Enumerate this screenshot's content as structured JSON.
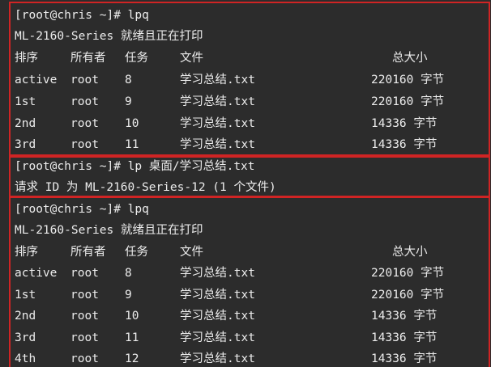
{
  "terminal": {
    "block1": {
      "prompt": "[root@chris ~]# lpq",
      "status": "ML-2160-Series 就绪且正在打印",
      "headers": {
        "rank": "排序",
        "owner": "所有者",
        "job": "任务",
        "file": "文件",
        "size": "总大小"
      },
      "rows": [
        {
          "rank": "active",
          "owner": "root",
          "job": "8",
          "file": "学习总结.txt",
          "size": "220160 字节"
        },
        {
          "rank": "1st",
          "owner": "root",
          "job": "9",
          "file": "学习总结.txt",
          "size": "220160 字节"
        },
        {
          "rank": "2nd",
          "owner": "root",
          "job": "10",
          "file": "学习总结.txt",
          "size": "14336 字节"
        },
        {
          "rank": "3rd",
          "owner": "root",
          "job": "11",
          "file": "学习总结.txt",
          "size": "14336 字节"
        }
      ]
    },
    "block2": {
      "prompt": "[root@chris ~]# lp 桌面/学习总结.txt",
      "result": "请求 ID 为 ML-2160-Series-12 (1 个文件)"
    },
    "block3": {
      "prompt": "[root@chris ~]# lpq",
      "status": "ML-2160-Series 就绪且正在打印",
      "headers": {
        "rank": "排序",
        "owner": "所有者",
        "job": "任务",
        "file": "文件",
        "size": "总大小"
      },
      "rows": [
        {
          "rank": "active",
          "owner": "root",
          "job": "8",
          "file": "学习总结.txt",
          "size": "220160 字节"
        },
        {
          "rank": "1st",
          "owner": "root",
          "job": "9",
          "file": "学习总结.txt",
          "size": "220160 字节"
        },
        {
          "rank": "2nd",
          "owner": "root",
          "job": "10",
          "file": "学习总结.txt",
          "size": "14336 字节"
        },
        {
          "rank": "3rd",
          "owner": "root",
          "job": "11",
          "file": "学习总结.txt",
          "size": "14336 字节"
        },
        {
          "rank": "4th",
          "owner": "root",
          "job": "12",
          "file": "学习总结.txt",
          "size": "14336 字节"
        }
      ]
    },
    "colors": {
      "background": "#2c2c2c",
      "text": "#ececec",
      "highlight_border": "#d02424"
    }
  }
}
